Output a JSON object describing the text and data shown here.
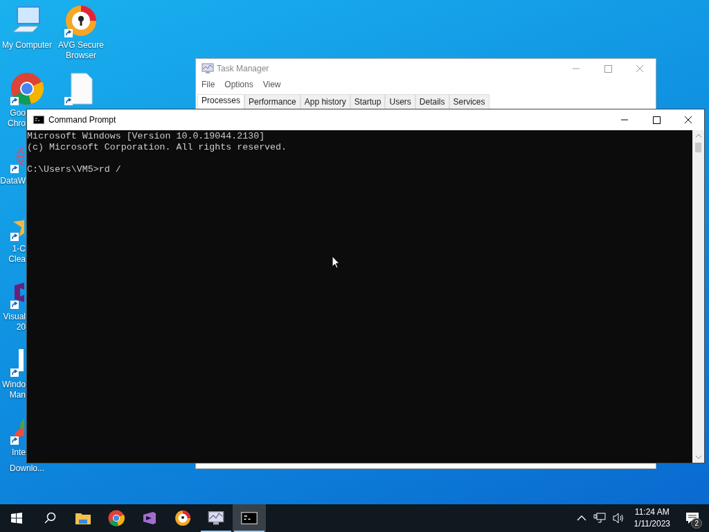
{
  "desktop_icons": [
    {
      "kind": "computer",
      "shortcut": false,
      "label": [
        "My Computer"
      ]
    },
    {
      "kind": "chrome",
      "shortcut": true,
      "label": [
        "Goo",
        "Chro"
      ]
    },
    {
      "kind": "dataw",
      "shortcut": true,
      "label": [
        "DataW"
      ]
    },
    {
      "kind": "ccleaner",
      "shortcut": true,
      "label": [
        "1-C",
        "Clea"
      ]
    },
    {
      "kind": "vs",
      "shortcut": true,
      "label": [
        "Visual",
        "20"
      ]
    },
    {
      "kind": "win10",
      "shortcut": true,
      "label": [
        "Windo",
        "Man"
      ]
    },
    {
      "kind": "idm",
      "shortcut": true,
      "label": [
        "Inte",
        "Downlo..."
      ]
    },
    {
      "kind": "avg",
      "shortcut": true,
      "label": [
        "AVG Secure",
        "Browser"
      ]
    },
    {
      "kind": "file",
      "shortcut": true
    }
  ],
  "task_manager": {
    "title": "Task Manager",
    "menu": [
      "File",
      "Options",
      "View"
    ],
    "tabs": [
      {
        "label": "Processes",
        "selected": true
      },
      {
        "label": "Performance",
        "selected": false
      },
      {
        "label": "App history",
        "selected": false
      },
      {
        "label": "Startup",
        "selected": false
      },
      {
        "label": "Users",
        "selected": false
      },
      {
        "label": "Details",
        "selected": false
      },
      {
        "label": "Services",
        "selected": false
      }
    ]
  },
  "command_prompt": {
    "title": "Command Prompt",
    "blocks": [
      [
        "Microsoft Windows [Version 10.0.19044.2130]",
        "(c) Microsoft Corporation. All rights reserved."
      ],
      [
        "C:\\Users\\VM5>rd /"
      ]
    ]
  },
  "taskbar": {
    "items": [
      {
        "kind": "start",
        "running": false,
        "active": false
      },
      {
        "kind": "search",
        "running": false,
        "active": false
      },
      {
        "kind": "explorer",
        "running": false,
        "active": false
      },
      {
        "kind": "chrome",
        "running": false,
        "active": false
      },
      {
        "kind": "vs",
        "running": false,
        "active": false
      },
      {
        "kind": "avg",
        "running": false,
        "active": false
      },
      {
        "kind": "taskmgr",
        "running": true,
        "active": false
      },
      {
        "kind": "cmd",
        "running": true,
        "active": true
      }
    ],
    "time": "11:24 AM",
    "date": "1/11/2023",
    "notification_count": "2"
  }
}
